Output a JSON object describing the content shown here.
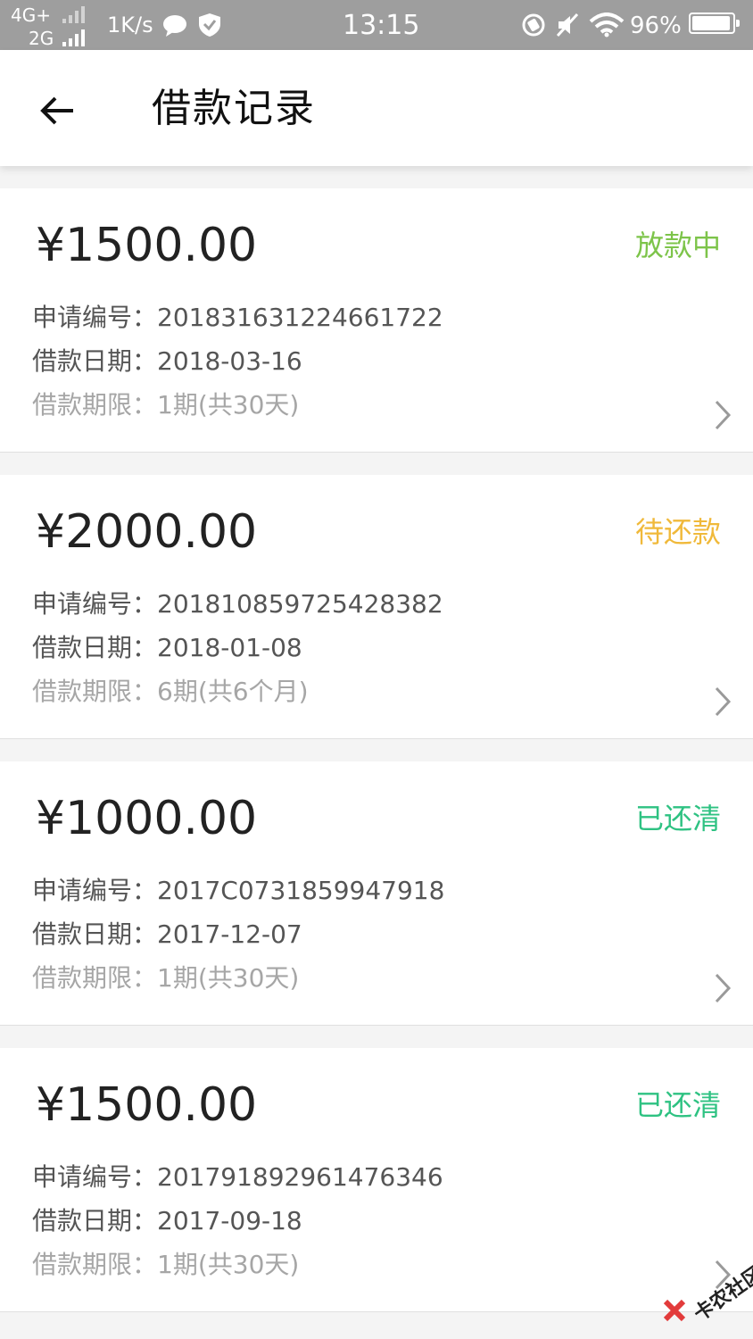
{
  "status_bar": {
    "network_top": "4G+",
    "network_bottom": "2G",
    "speed": "1K/s",
    "time": "13:15",
    "battery": "96%",
    "battery_level": 0.96
  },
  "header": {
    "title": "借款记录"
  },
  "labels": {
    "application_no": "申请编号：",
    "loan_date": "借款日期：",
    "loan_term": "借款期限："
  },
  "records": [
    {
      "amount": "¥1500.00",
      "status": "放款中",
      "status_color": "#7dc44a",
      "application_no": "201831631224661722",
      "loan_date": "2018-03-16",
      "loan_term": "1期(共30天)"
    },
    {
      "amount": "¥2000.00",
      "status": "待还款",
      "status_color": "#f0b93a",
      "application_no": "201810859725428382",
      "loan_date": "2018-01-08",
      "loan_term": "6期(共6个月)"
    },
    {
      "amount": "¥1000.00",
      "status": "已还清",
      "status_color": "#2ec282",
      "application_no": "2017C0731859947918",
      "loan_date": "2017-12-07",
      "loan_term": "1期(共30天)"
    },
    {
      "amount": "¥1500.00",
      "status": "已还清",
      "status_color": "#2ec282",
      "application_no": "201791892961476346",
      "loan_date": "2017-09-18",
      "loan_term": "1期(共30天)"
    }
  ],
  "watermark": {
    "text": "卡农社区"
  },
  "colors": {
    "status_bar_bg": "#9e9e9e",
    "page_bg": "#f4f4f4",
    "card_bg": "#ffffff",
    "amount_text": "#222222",
    "primary_text": "#555555",
    "secondary_text": "#a6a6a6"
  },
  "icons": {
    "back": "arrow-left-icon",
    "chevron": "chevron-right-icon",
    "message": "message-bubble-icon",
    "shield": "shield-check-icon",
    "rotation": "rotation-lock-icon",
    "mute": "mute-icon",
    "wifi": "wifi-icon",
    "battery": "battery-icon"
  }
}
